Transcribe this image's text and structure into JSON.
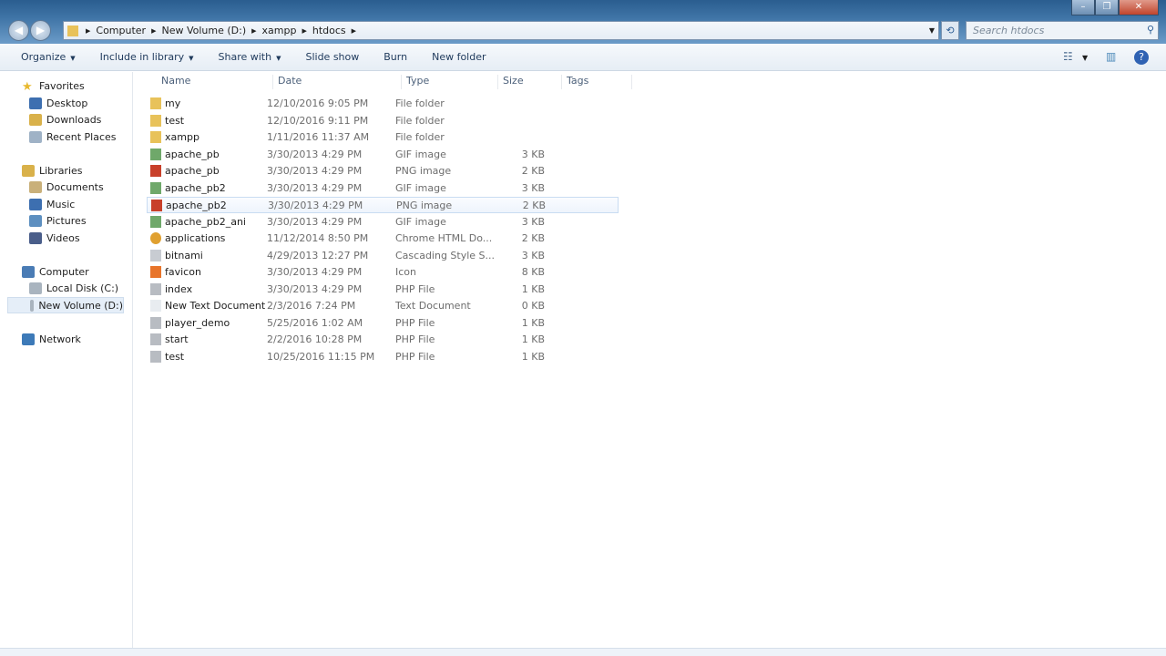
{
  "window": {
    "minimize": "–",
    "maximize": "❐",
    "close": "✕"
  },
  "address": {
    "crumbs": [
      "Computer",
      "New Volume (D:)",
      "xampp",
      "htdocs"
    ]
  },
  "search": {
    "placeholder": "Search htdocs"
  },
  "toolbar": {
    "items": [
      {
        "label": "Organize",
        "dropdown": true
      },
      {
        "label": "Include in library",
        "dropdown": true
      },
      {
        "label": "Share with",
        "dropdown": true
      },
      {
        "label": "Slide show",
        "dropdown": false
      },
      {
        "label": "Burn",
        "dropdown": false
      },
      {
        "label": "New folder",
        "dropdown": false
      }
    ]
  },
  "sidebar": {
    "items": [
      {
        "label": "Favorites",
        "level": 0,
        "icon": "star-icon",
        "color": "#e8b92e"
      },
      {
        "label": "Desktop",
        "level": 1,
        "icon": "desktop-icon",
        "color": "#3d6fb0"
      },
      {
        "label": "Downloads",
        "level": 1,
        "icon": "downloads-icon",
        "color": "#d9b14a"
      },
      {
        "label": "Recent Places",
        "level": 1,
        "icon": "recent-places-icon",
        "color": "#9fb2c6"
      },
      {
        "label": "Libraries",
        "level": 0,
        "icon": "libraries-icon",
        "color": "#d9b14a"
      },
      {
        "label": "Documents",
        "level": 1,
        "icon": "documents-icon",
        "color": "#c9b07a"
      },
      {
        "label": "Music",
        "level": 1,
        "icon": "music-icon",
        "color": "#3d6fb0"
      },
      {
        "label": "Pictures",
        "level": 1,
        "icon": "pictures-icon",
        "color": "#5d8fc0"
      },
      {
        "label": "Videos",
        "level": 1,
        "icon": "videos-icon",
        "color": "#4a5e8a"
      },
      {
        "label": "Computer",
        "level": 0,
        "icon": "computer-icon",
        "color": "#4a7cb5"
      },
      {
        "label": "Local Disk (C:)",
        "level": 1,
        "icon": "drive-icon",
        "color": "#a9b4bf"
      },
      {
        "label": "New Volume (D:)",
        "level": 1,
        "icon": "drive-icon",
        "color": "#a9b4bf",
        "selected": true
      },
      {
        "label": "Network",
        "level": 0,
        "icon": "network-icon",
        "color": "#3d7ab8"
      }
    ]
  },
  "columns": [
    "Name",
    "Date",
    "Type",
    "Size",
    "Tags"
  ],
  "files": [
    {
      "name": "my",
      "date": "12/10/2016 9:05 PM",
      "type": "File folder",
      "size": "",
      "icon": "folder-icon",
      "color": "#e8c25a"
    },
    {
      "name": "test",
      "date": "12/10/2016 9:11 PM",
      "type": "File folder",
      "size": "",
      "icon": "folder-icon",
      "color": "#e8c25a"
    },
    {
      "name": "xampp",
      "date": "1/11/2016 11:37 AM",
      "type": "File folder",
      "size": "",
      "icon": "folder-icon",
      "color": "#e8c25a"
    },
    {
      "name": "apache_pb",
      "date": "3/30/2013 4:29 PM",
      "type": "GIF image",
      "size": "3 KB",
      "icon": "gif-image-icon",
      "color": "#6fa86a"
    },
    {
      "name": "apache_pb",
      "date": "3/30/2013 4:29 PM",
      "type": "PNG image",
      "size": "2 KB",
      "icon": "png-image-icon",
      "color": "#c8402a"
    },
    {
      "name": "apache_pb2",
      "date": "3/30/2013 4:29 PM",
      "type": "GIF image",
      "size": "3 KB",
      "icon": "gif-image-icon",
      "color": "#6fa86a"
    },
    {
      "name": "apache_pb2",
      "date": "3/30/2013 4:29 PM",
      "type": "PNG image",
      "size": "2 KB",
      "icon": "png-image-icon",
      "color": "#c8402a",
      "hover": true
    },
    {
      "name": "apache_pb2_ani",
      "date": "3/30/2013 4:29 PM",
      "type": "GIF image",
      "size": "3 KB",
      "icon": "gif-image-icon",
      "color": "#6fa86a"
    },
    {
      "name": "applications",
      "date": "11/12/2014 8:50 PM",
      "type": "Chrome HTML Do...",
      "size": "2 KB",
      "icon": "chrome-icon",
      "color": "#e0a030"
    },
    {
      "name": "bitnami",
      "date": "4/29/2013 12:27 PM",
      "type": "Cascading Style S...",
      "size": "3 KB",
      "icon": "css-file-icon",
      "color": "#c8ccd2"
    },
    {
      "name": "favicon",
      "date": "3/30/2013 4:29 PM",
      "type": "Icon",
      "size": "8 KB",
      "icon": "xampp-icon",
      "color": "#e8742a"
    },
    {
      "name": "index",
      "date": "3/30/2013 4:29 PM",
      "type": "PHP File",
      "size": "1 KB",
      "icon": "php-file-icon",
      "color": "#b8bcc2"
    },
    {
      "name": "New Text Document",
      "date": "2/3/2016 7:24 PM",
      "type": "Text Document",
      "size": "0 KB",
      "icon": "text-file-icon",
      "color": "#e8ecf0"
    },
    {
      "name": "player_demo",
      "date": "5/25/2016 1:02 AM",
      "type": "PHP File",
      "size": "1 KB",
      "icon": "php-file-icon",
      "color": "#b8bcc2"
    },
    {
      "name": "start",
      "date": "2/2/2016 10:28 PM",
      "type": "PHP File",
      "size": "1 KB",
      "icon": "php-file-icon",
      "color": "#b8bcc2"
    },
    {
      "name": "test",
      "date": "10/25/2016 11:15 PM",
      "type": "PHP File",
      "size": "1 KB",
      "icon": "php-file-icon",
      "color": "#b8bcc2"
    }
  ]
}
